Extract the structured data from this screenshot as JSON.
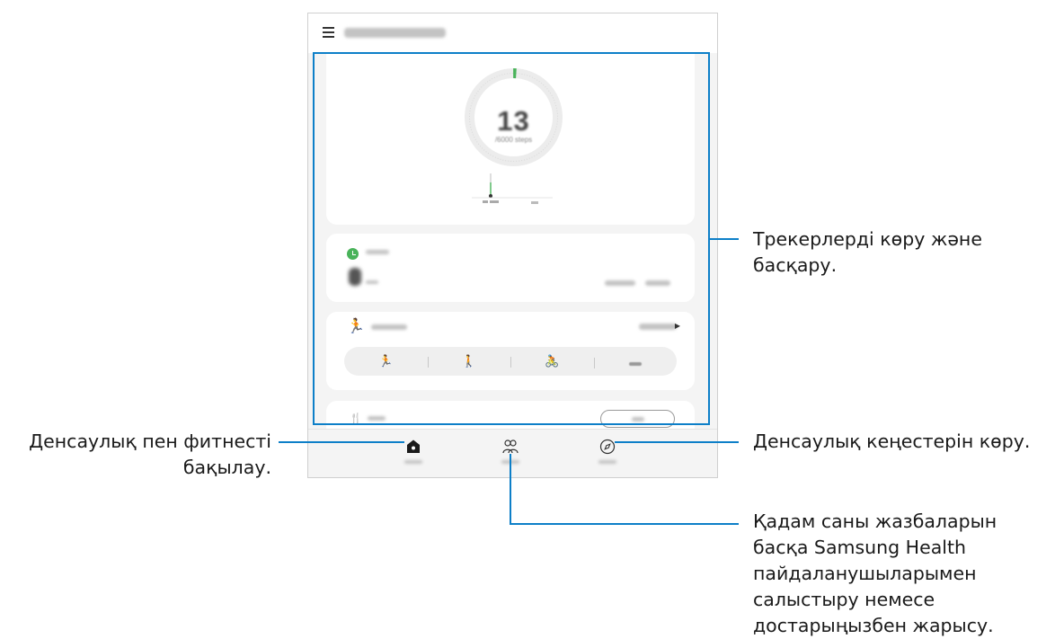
{
  "app": {
    "header": {
      "menu_icon": "menu-icon"
    },
    "steps": {
      "count": "13",
      "goal": "/6000 steps"
    },
    "active_time": {
      "icon": "clock-icon"
    },
    "exercise": {
      "icon": "running-icon",
      "types": [
        {
          "icon": "running-icon",
          "glyph": "🏃"
        },
        {
          "icon": "walking-icon",
          "glyph": "🚶"
        },
        {
          "icon": "cycling-icon",
          "glyph": "🚴"
        },
        {
          "icon": "more-icon",
          "glyph": ""
        }
      ]
    },
    "food": {
      "icon": "fork-knife-icon"
    },
    "bottom_nav": [
      {
        "id": "home",
        "icon": "home-icon"
      },
      {
        "id": "together",
        "icon": "people-icon"
      },
      {
        "id": "discover",
        "icon": "compass-icon"
      }
    ]
  },
  "callouts": {
    "trackers": [
      "Трекерлерді көру және",
      "басқару."
    ],
    "monitor": [
      "Денсаулық пен фитнесті",
      "бақылау."
    ],
    "tips": [
      "Денсаулық кеңестерін көру."
    ],
    "compare": [
      "Қадам саны жазбаларын",
      "басқа Samsung Health",
      "пайдаланушыларымен",
      "салыстыру немесе",
      "достарыңызбен жарысу."
    ]
  },
  "colors": {
    "accent_blue": "#0d7fc8",
    "health_green": "#49b35a"
  }
}
